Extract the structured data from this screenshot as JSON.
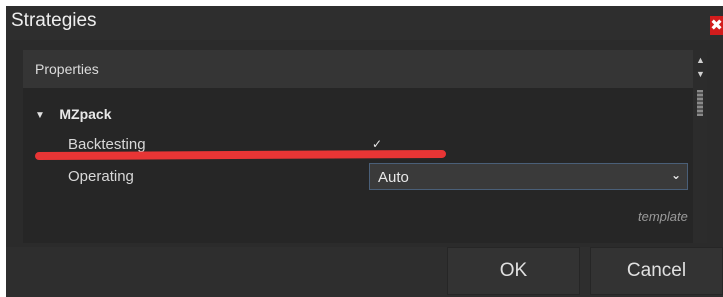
{
  "dialog": {
    "title": "Strategies",
    "close_icon": "close-icon",
    "close_symbol": "✖"
  },
  "panel": {
    "header": "Properties",
    "group": {
      "label": "MZpack",
      "expanded": true,
      "arrow_icon": "caret-down-icon"
    },
    "properties": [
      {
        "label": "Backtesting",
        "type": "checkbox",
        "checked": true,
        "check_symbol": "✓"
      },
      {
        "label": "Operating",
        "type": "select",
        "value": "Auto"
      }
    ],
    "template_label": "template"
  },
  "annotation": {
    "color": "#e83535"
  },
  "buttons": {
    "ok": "OK",
    "cancel": "Cancel"
  },
  "colors": {
    "background": "#2b2b2b",
    "close": "#d21c1c",
    "select_border": "#4a5f78"
  }
}
